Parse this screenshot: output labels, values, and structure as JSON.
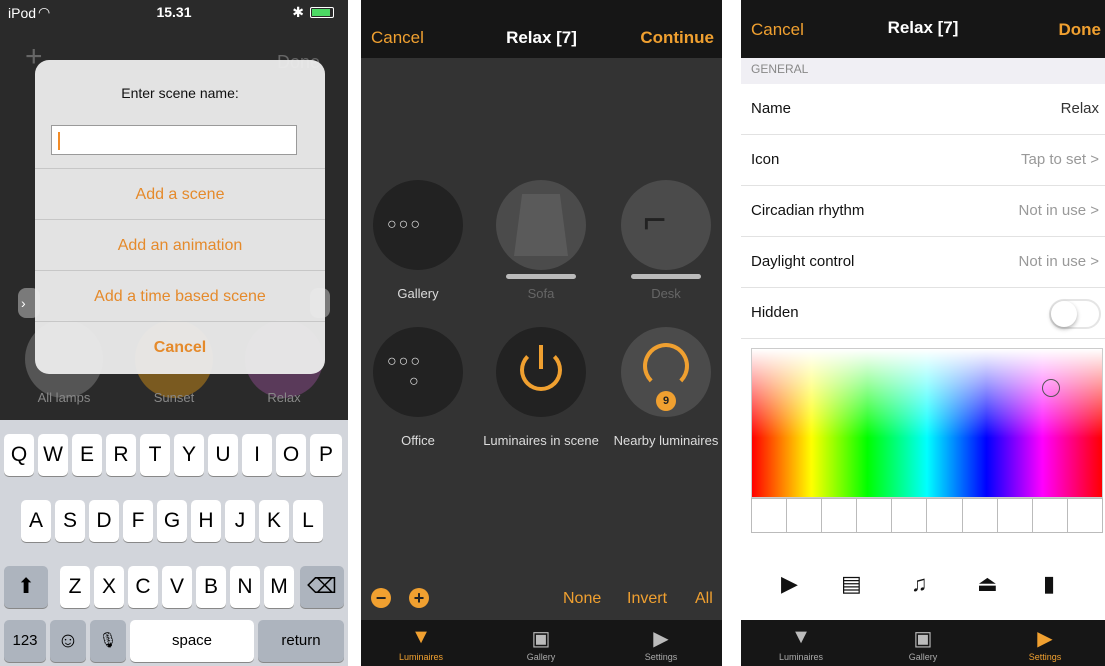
{
  "screen1": {
    "status": {
      "carrier": "iPod",
      "wifi_icon": "wifi-icon",
      "time": "15.31",
      "bluetooth_icon": "bluetooth-icon",
      "battery_icon": "battery-icon"
    },
    "background": {
      "add_symbol": "+",
      "done_label": "Done",
      "scenes": [
        {
          "label": "All lamps",
          "color": "#555555"
        },
        {
          "label": "Sunset",
          "color": "#7a5a20"
        },
        {
          "label": "Relax",
          "color": "#5a3a5a"
        }
      ]
    },
    "dialog": {
      "title": "Enter scene name:",
      "input_value": "",
      "actions": [
        "Add a scene",
        "Add an animation",
        "Add a time based scene",
        "Cancel"
      ]
    },
    "keyboard": {
      "row1": [
        "Q",
        "W",
        "E",
        "R",
        "T",
        "Y",
        "U",
        "I",
        "O",
        "P"
      ],
      "row2": [
        "A",
        "S",
        "D",
        "F",
        "G",
        "H",
        "J",
        "K",
        "L"
      ],
      "row3": [
        "Z",
        "X",
        "C",
        "V",
        "B",
        "N",
        "M"
      ],
      "shift": "⬆",
      "backspace": "⌫",
      "numbers": "123",
      "emoji": "☺",
      "mic": "🎙",
      "space": "space",
      "return": "return"
    }
  },
  "screen2": {
    "nav": {
      "cancel": "Cancel",
      "title": "Relax [7]",
      "continue": "Continue"
    },
    "tiles": [
      {
        "label": "Gallery",
        "bulbs": "○○○"
      },
      {
        "label": "Sofa"
      },
      {
        "label": "Desk"
      },
      {
        "label": "Office",
        "bulbs": "○○○"
      },
      {
        "label": "Luminaires in scene",
        "icon": "power-icon"
      },
      {
        "label": "Nearby luminaires",
        "icon": "wireless-icon",
        "badge": "9"
      }
    ],
    "bottom": {
      "minus": "−",
      "plus": "+",
      "none": "None",
      "invert": "Invert",
      "all": "All"
    },
    "tabs": [
      {
        "label": "Luminaires",
        "icon": "lamp-icon"
      },
      {
        "label": "Gallery",
        "icon": "gallery-icon"
      },
      {
        "label": "Settings",
        "icon": "clapper-icon"
      }
    ]
  },
  "screen3": {
    "nav": {
      "cancel": "Cancel",
      "title": "Relax [7]",
      "done": "Done"
    },
    "section": "GENERAL",
    "rows": [
      {
        "label": "Name",
        "value": "Relax"
      },
      {
        "label": "Icon",
        "value": "Tap to set >"
      },
      {
        "label": "Circadian rhythm",
        "value": "Not in use >"
      },
      {
        "label": "Daylight control",
        "value": "Not in use >"
      },
      {
        "label": "Hidden"
      }
    ],
    "toolbar_icons": [
      "clapper-icon",
      "remote-icon",
      "music-icon",
      "desk-lamp-icon",
      "book-icon"
    ],
    "tabs": [
      {
        "label": "Luminaires",
        "icon": "lamp-icon"
      },
      {
        "label": "Gallery",
        "icon": "gallery-icon"
      },
      {
        "label": "Settings",
        "icon": "clapper-icon"
      }
    ]
  }
}
